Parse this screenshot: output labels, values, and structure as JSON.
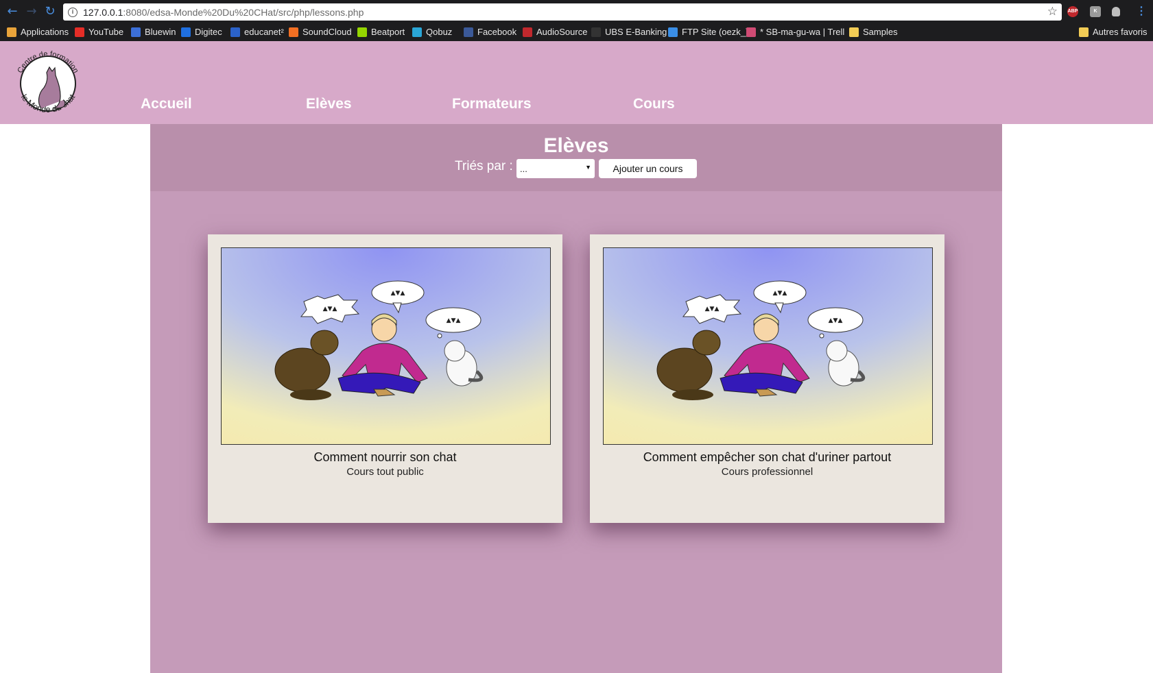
{
  "browser": {
    "url_host": "127.0.0.1",
    "url_path": ":8080/edsa-Monde%20Du%20CHat/src/php/lessons.php",
    "extensions": [
      "ABP",
      "K",
      ""
    ],
    "bookmarks": [
      {
        "label": "Applications",
        "icon": "apps-grid-icon",
        "color": "#e8a33a"
      },
      {
        "label": "YouTube",
        "icon": "youtube-icon",
        "color": "#e52d27"
      },
      {
        "label": "Bluewin",
        "icon": "bluewin-icon",
        "color": "#3c6fd8"
      },
      {
        "label": "Digitec",
        "icon": "digitec-icon",
        "color": "#1f6fe0"
      },
      {
        "label": "educanet²",
        "icon": "educanet-icon",
        "color": "#2b62c9"
      },
      {
        "label": "SoundCloud",
        "icon": "soundcloud-icon",
        "color": "#f26f23"
      },
      {
        "label": "Beatport",
        "icon": "beatport-icon",
        "color": "#94d500"
      },
      {
        "label": "Qobuz",
        "icon": "qobuz-icon",
        "color": "#2aa6d6"
      },
      {
        "label": "Facebook",
        "icon": "facebook-icon",
        "color": "#3b5998"
      },
      {
        "label": "AudioSource",
        "icon": "audiosource-icon",
        "color": "#c0282d"
      },
      {
        "label": "UBS E-Banking",
        "icon": "ubs-icon",
        "color": "#333333"
      },
      {
        "label": "FTP Site (oezk_)",
        "icon": "ftp-icon",
        "color": "#3a8ee6"
      },
      {
        "label": "* SB-ma-gu-wa | Trell",
        "icon": "trello-icon",
        "color": "#d04b74"
      },
      {
        "label": "Samples",
        "icon": "folder-icon",
        "color": "#f2cc55"
      },
      {
        "label": "Autres favoris",
        "icon": "folder-icon",
        "color": "#f2cc55"
      }
    ]
  },
  "header": {
    "logo_top_text": "Centre de formation",
    "logo_bottom_text": "le Monde du chat",
    "nav": [
      "Accueil",
      "Elèves",
      "Formateurs",
      "Cours"
    ]
  },
  "toolbar": {
    "title": "Elèves",
    "sort_label": "Triés par :",
    "sort_value": "...",
    "add_button": "Ajouter un cours"
  },
  "courses": [
    {
      "title": "Comment nourrir son chat",
      "subtitle": "Cours tout public"
    },
    {
      "title": "Comment empêcher son chat d'uriner partout",
      "subtitle": "Cours professionnel"
    }
  ],
  "colors": {
    "header_bg": "#d7a9c9",
    "main_bg": "#c59bb9",
    "toolbar_bg": "#b98fab",
    "card_bg": "#ebe6df"
  }
}
